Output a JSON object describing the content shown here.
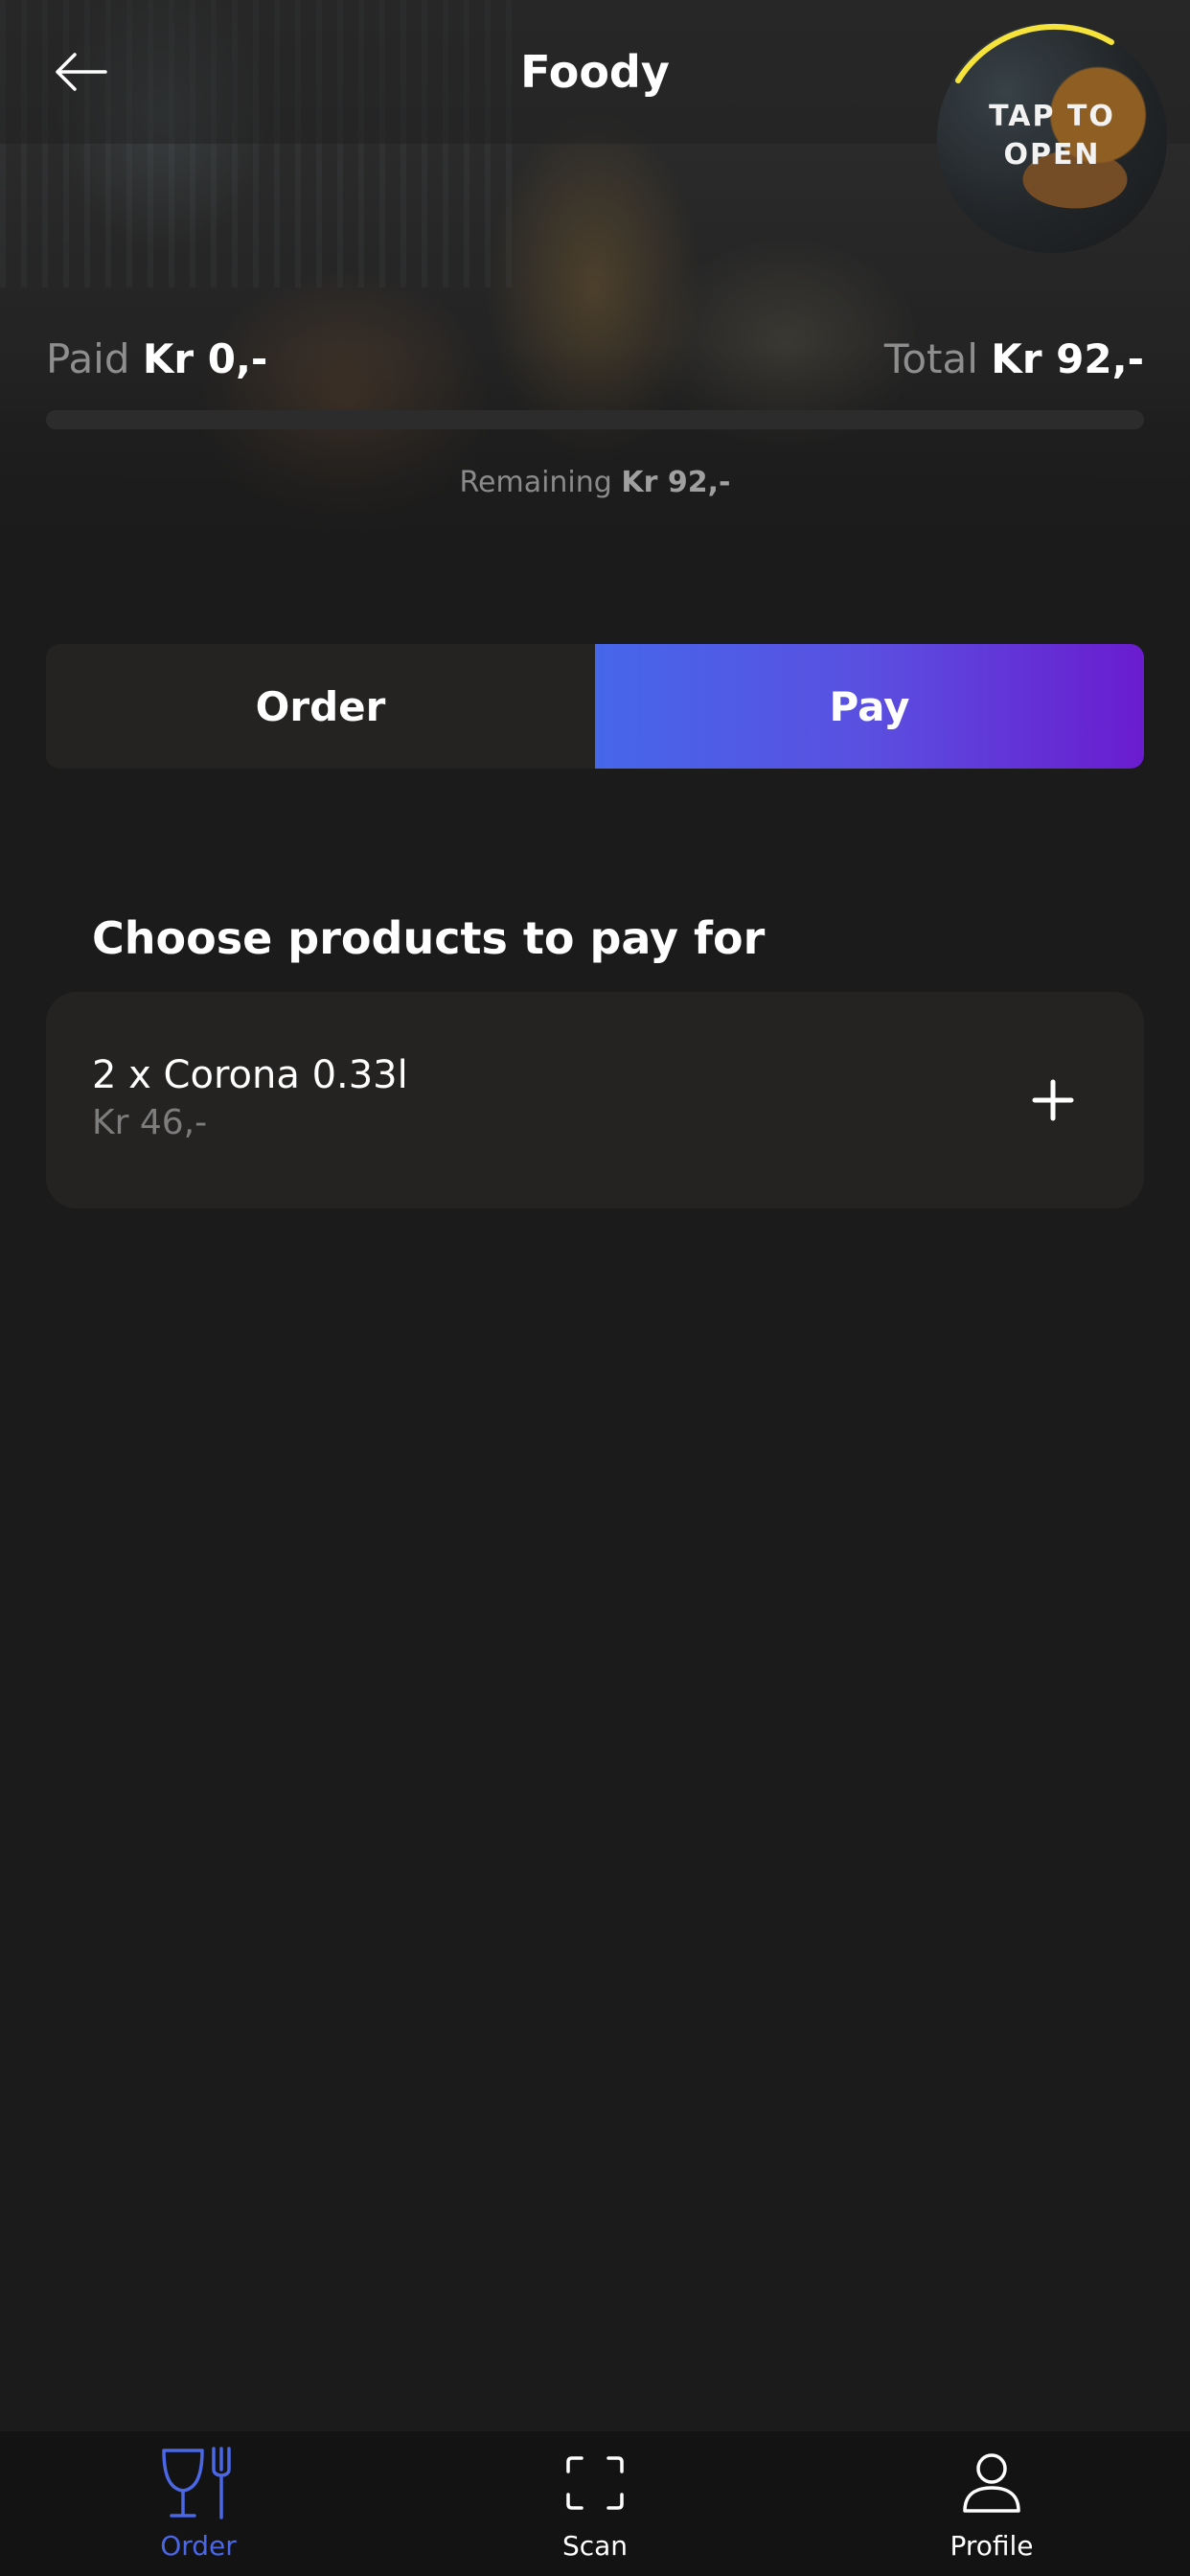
{
  "header": {
    "title": "Foody",
    "back_icon": "arrow-left-icon",
    "tap_to_open": "TAP TO OPEN",
    "tap_ring_color": "#f5e23a"
  },
  "payment": {
    "paid_label": "Paid",
    "paid_value": "Kr 0,-",
    "total_label": "Total",
    "total_value": "Kr 92,-",
    "remaining_label": "Remaining",
    "remaining_value": "Kr 92,-",
    "progress_fraction": 0
  },
  "segment": {
    "order_label": "Order",
    "pay_label": "Pay",
    "selected": "Pay",
    "accent_gradient": [
      "#4667ea",
      "#6a1ccf"
    ]
  },
  "products": {
    "heading": "Choose products to pay for",
    "items": [
      {
        "name": "2 x Corona 0.33l",
        "price": "Kr 46,-",
        "action_icon": "plus-icon"
      }
    ]
  },
  "bottom_nav": {
    "active_color": "#4b67e6",
    "items": [
      {
        "label": "Order",
        "icon": "wine-glass-fork-icon",
        "active": true
      },
      {
        "label": "Scan",
        "icon": "scan-frame-icon",
        "active": false
      },
      {
        "label": "Profile",
        "icon": "person-icon",
        "active": false
      }
    ]
  }
}
